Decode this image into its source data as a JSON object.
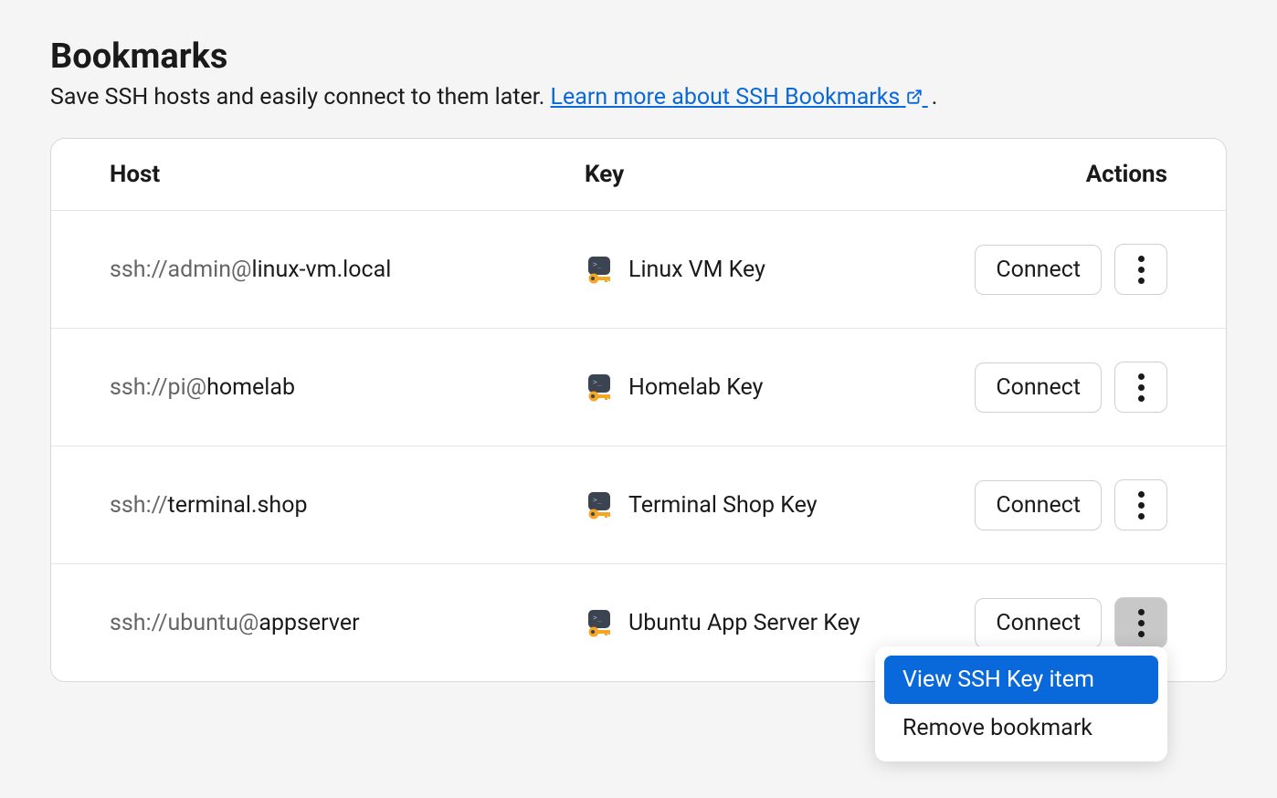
{
  "header": {
    "title": "Bookmarks",
    "subtitle_text": "Save SSH hosts and easily connect to them later. ",
    "learn_more_text": "Learn more about SSH Bookmarks"
  },
  "table": {
    "columns": {
      "host": "Host",
      "key": "Key",
      "actions": "Actions"
    },
    "connect_label": "Connect",
    "rows": [
      {
        "host_prefix": "ssh://admin@",
        "host_domain": "linux-vm.local",
        "key_name": "Linux VM Key",
        "menu_open": false
      },
      {
        "host_prefix": "ssh://pi@",
        "host_domain": "homelab",
        "key_name": "Homelab Key",
        "menu_open": false
      },
      {
        "host_prefix": "ssh://",
        "host_domain": "terminal.shop",
        "key_name": "Terminal Shop Key",
        "menu_open": false
      },
      {
        "host_prefix": "ssh://ubuntu@",
        "host_domain": "appserver",
        "key_name": "Ubuntu App Server Key",
        "menu_open": true
      }
    ]
  },
  "dropdown": {
    "view_key": "View SSH Key item",
    "remove": "Remove bookmark"
  }
}
